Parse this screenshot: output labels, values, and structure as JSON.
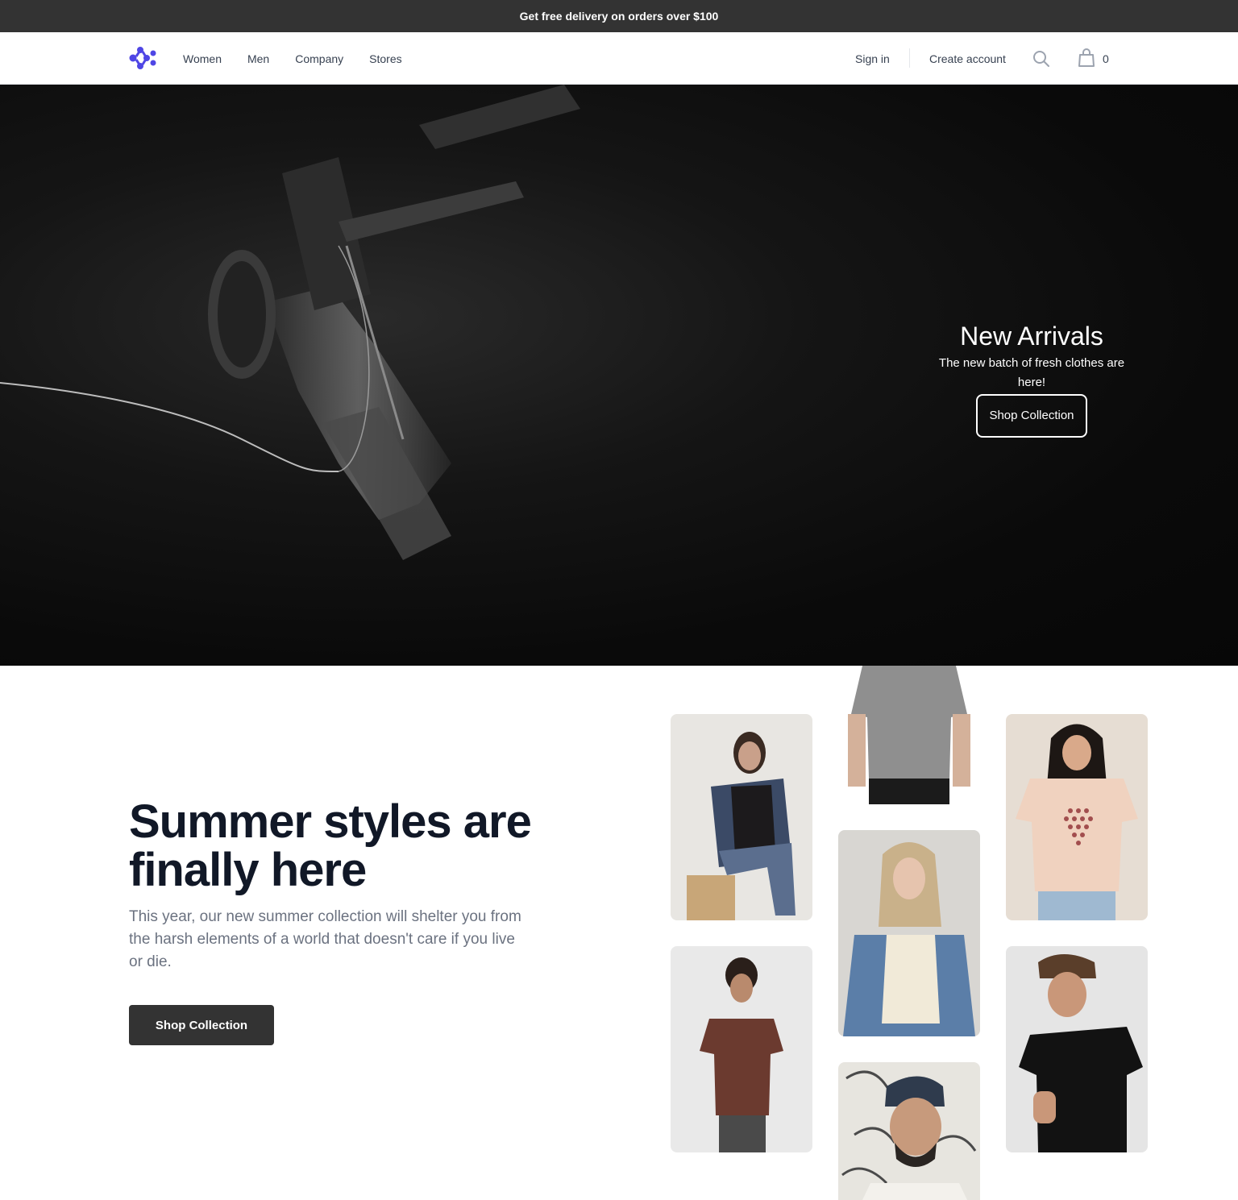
{
  "announcement": "Get free delivery on orders over $100",
  "header": {
    "logo": "workflow-logo",
    "nav": [
      "Women",
      "Men",
      "Company",
      "Stores"
    ],
    "sign_in": "Sign in",
    "create_account": "Create account",
    "cart_count": "0"
  },
  "hero": {
    "title": "New Arrivals",
    "subtitle": "The new batch of fresh clothes are here!",
    "button": "Shop Collection"
  },
  "promo": {
    "title": "Summer styles are finally here",
    "text": "This year, our new summer collection will shelter you from the harsh elements of a world that doesn't care if you live or die.",
    "button": "Shop Collection"
  },
  "colors": {
    "announcement_bg": "#333333",
    "logo": "#4f46e5",
    "heading": "#111827",
    "body_text": "#6b7280"
  }
}
